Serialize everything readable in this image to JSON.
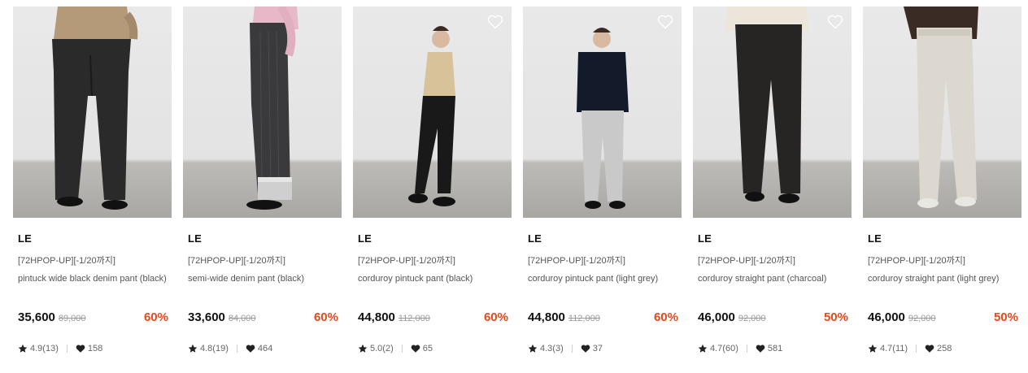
{
  "products": [
    {
      "brand": "LE",
      "promo": "[72HPOP-UP][-1/20까지]",
      "name": "pintuck wide black denim pant (black)",
      "price": "35,600",
      "original_price": "89,000",
      "discount": "60%",
      "rating": "4.9(13)",
      "likes": "158",
      "wishlist_visible": false
    },
    {
      "brand": "LE",
      "promo": "[72HPOP-UP][-1/20까지]",
      "name": "semi-wide denim pant (black)",
      "price": "33,600",
      "original_price": "84,000",
      "discount": "60%",
      "rating": "4.8(19)",
      "likes": "464",
      "wishlist_visible": false
    },
    {
      "brand": "LE",
      "promo": "[72HPOP-UP][-1/20까지]",
      "name": "corduroy pintuck pant (black)",
      "price": "44,800",
      "original_price": "112,000",
      "discount": "60%",
      "rating": "5.0(2)",
      "likes": "65",
      "wishlist_visible": true
    },
    {
      "brand": "LE",
      "promo": "[72HPOP-UP][-1/20까지]",
      "name": "corduroy pintuck pant (light grey)",
      "price": "44,800",
      "original_price": "112,000",
      "discount": "60%",
      "rating": "4.3(3)",
      "likes": "37",
      "wishlist_visible": true
    },
    {
      "brand": "LE",
      "promo": "[72HPOP-UP][-1/20까지]",
      "name": "corduroy straight pant (charcoal)",
      "price": "46,000",
      "original_price": "92,000",
      "discount": "50%",
      "rating": "4.7(60)",
      "likes": "581",
      "wishlist_visible": true
    },
    {
      "brand": "LE",
      "promo": "[72HPOP-UP][-1/20까지]",
      "name": "corduroy straight pant (light grey)",
      "price": "46,000",
      "original_price": "92,000",
      "discount": "50%",
      "rating": "4.7(11)",
      "likes": "258",
      "wishlist_visible": false
    }
  ],
  "colors": {
    "discount": "#e8471b",
    "price": "#111111",
    "original_price": "#9a9a9a",
    "meta_text": "#666666"
  },
  "icons": {
    "rating": "star-icon",
    "likes": "heart-icon",
    "wishlist": "heart-outline-icon"
  }
}
